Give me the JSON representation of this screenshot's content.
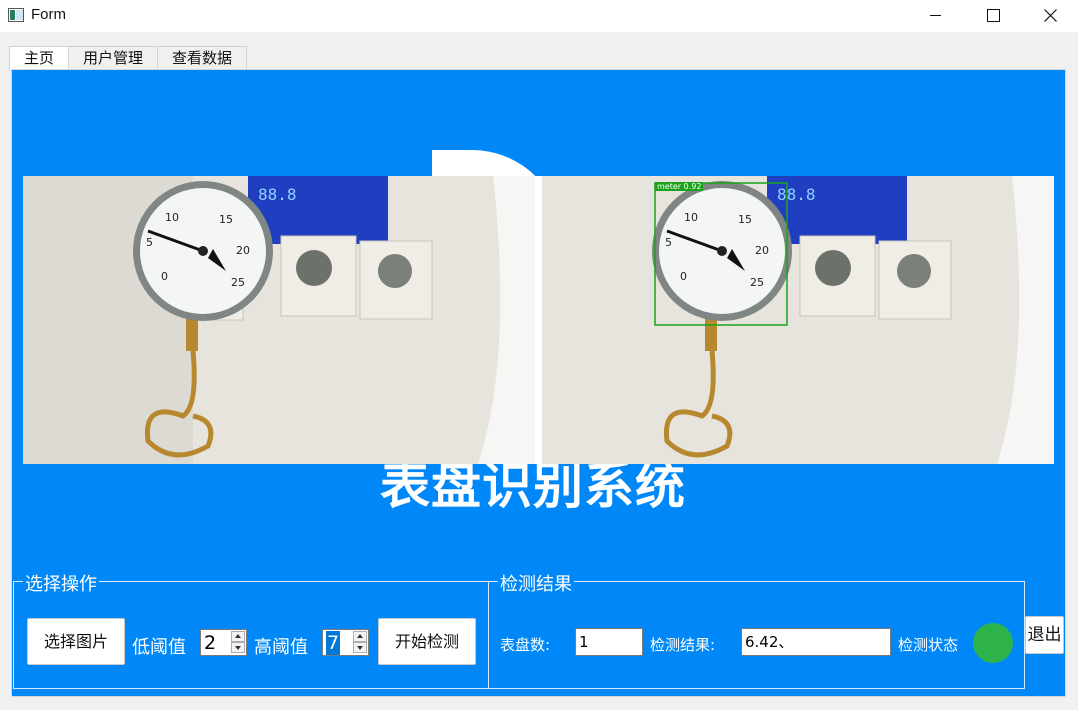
{
  "window": {
    "title": "Form"
  },
  "tabs": [
    {
      "label": "主页"
    },
    {
      "label": "用户管理"
    },
    {
      "label": "查看数据"
    }
  ],
  "main": {
    "background_title": "表盘识别系统",
    "detection_box_label": "meter 0.92"
  },
  "operations": {
    "group_title": "选择操作",
    "select_image_label": "选择图片",
    "low_threshold_label": "低阈值",
    "low_threshold_value": "2",
    "high_threshold_label": "高阈值",
    "high_threshold_value": "7",
    "start_detect_label": "开始检测"
  },
  "results": {
    "group_title": "检测结果",
    "dial_count_label": "表盘数:",
    "dial_count_value": "1",
    "detect_result_label": "检测结果:",
    "detect_result_value": "6.42、",
    "detect_status_label": "检测状态",
    "status_color": "#2db34a"
  },
  "exit_label": "退出",
  "colors": {
    "panel": "#0088f8",
    "box": "#1aa31a"
  }
}
